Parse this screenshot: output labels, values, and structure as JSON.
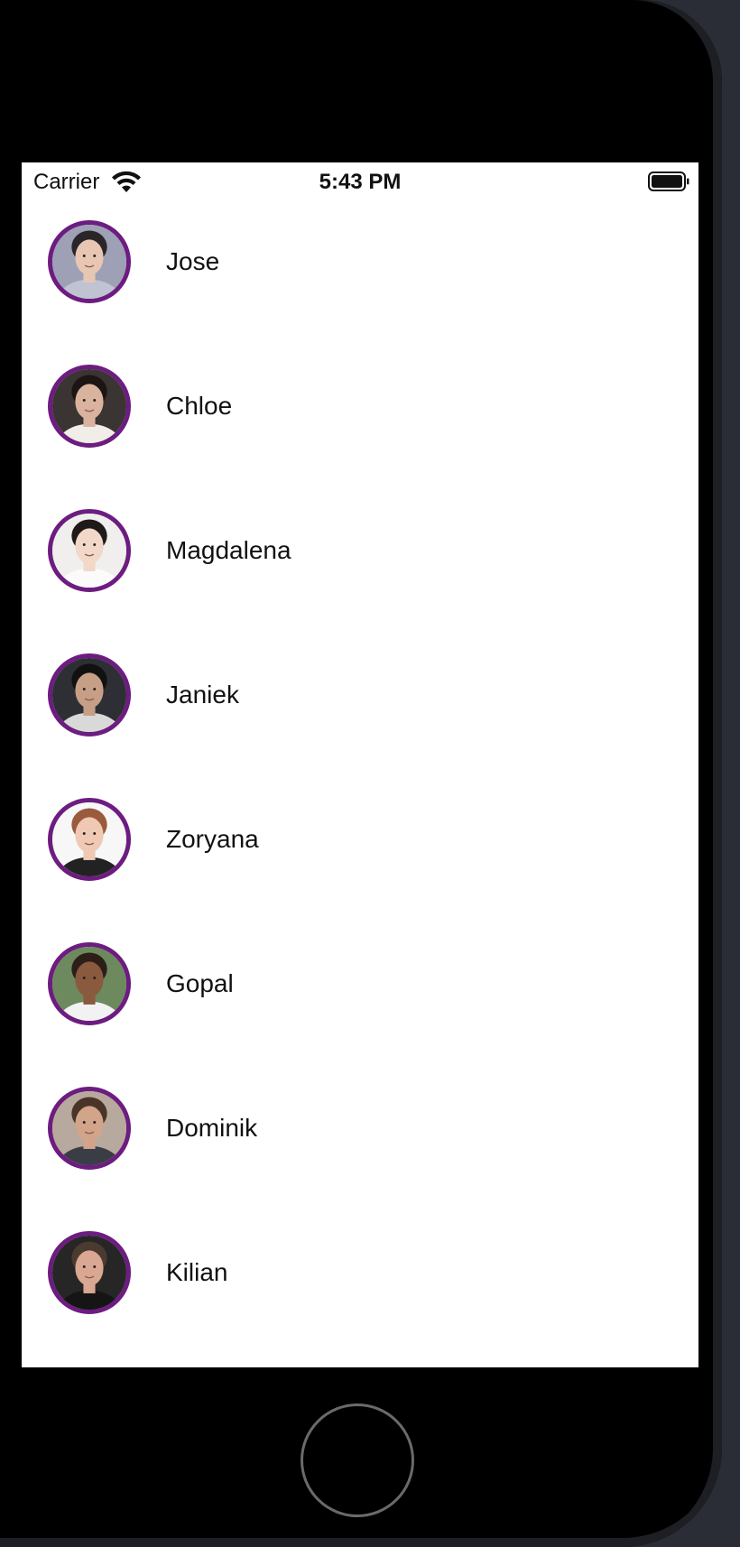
{
  "status_bar": {
    "carrier": "Carrier",
    "time": "5:43 PM",
    "icons": [
      "wifi-icon",
      "battery-icon"
    ]
  },
  "contacts": [
    {
      "name": "Jose",
      "avatar_colors": {
        "bg": "#9ea0b5",
        "skin": "#e7c6b3",
        "hair": "#2a2528",
        "shirt": "#bfc3d2"
      }
    },
    {
      "name": "Chloe",
      "avatar_colors": {
        "bg": "#3a3433",
        "skin": "#d9b39d",
        "hair": "#1c1514",
        "shirt": "#f1ede9"
      }
    },
    {
      "name": "Magdalena",
      "avatar_colors": {
        "bg": "#f0efee",
        "skin": "#f1d8c8",
        "hair": "#1f1a18",
        "shirt": "#fbfbfb"
      }
    },
    {
      "name": "Janiek",
      "avatar_colors": {
        "bg": "#2e2f34",
        "skin": "#c79f86",
        "hair": "#111111",
        "shirt": "#d9d9d9"
      }
    },
    {
      "name": "Zoryana",
      "avatar_colors": {
        "bg": "#f7f7f7",
        "skin": "#efc9b4",
        "hair": "#9a5a3c",
        "shirt": "#222222"
      }
    },
    {
      "name": "Gopal",
      "avatar_colors": {
        "bg": "#6c8a5d",
        "skin": "#8a5a3f",
        "hair": "#2b1f18",
        "shirt": "#f2f2f2"
      }
    },
    {
      "name": "Dominik",
      "avatar_colors": {
        "bg": "#b7a99d",
        "skin": "#d2a48a",
        "hair": "#4a3428",
        "shirt": "#3a3d46"
      }
    },
    {
      "name": "Kilian",
      "avatar_colors": {
        "bg": "#262626",
        "skin": "#d9a792",
        "hair": "#4b3a30",
        "shirt": "#151515"
      }
    }
  ],
  "colors": {
    "avatar_ring": "#6d1c80",
    "screen_bg": "#ffffff",
    "device": "#000000"
  }
}
